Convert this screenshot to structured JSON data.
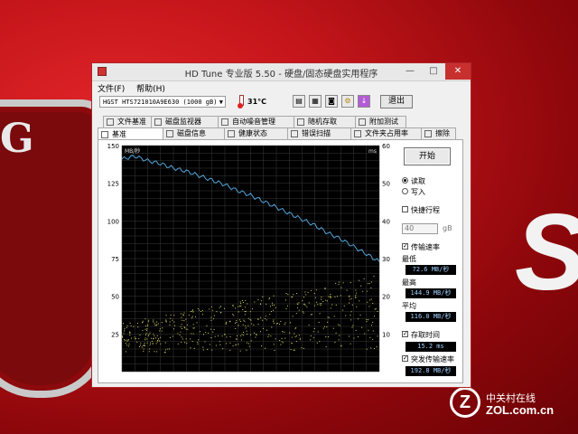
{
  "window": {
    "title": "HD Tune 专业版 5.50 - 硬盘/固态硬盘实用程序",
    "minimize": "—",
    "maximize": "□",
    "close": "✕"
  },
  "menu": {
    "file": "文件(F)",
    "help": "帮助(H)"
  },
  "toolbar": {
    "drive": "HGST HTS721010A9E630 (1000 gB)",
    "temperature": "31°C",
    "exit": "退出"
  },
  "tabs_row1": [
    {
      "label": "文件基准",
      "icon": "file-benchmark-icon"
    },
    {
      "label": "磁盘监视器",
      "icon": "disk-monitor-icon"
    },
    {
      "label": "自动噪音管理",
      "icon": "speaker-icon"
    },
    {
      "label": "随机存取",
      "icon": "random-access-icon"
    },
    {
      "label": "附加测试",
      "icon": "extra-tests-icon"
    }
  ],
  "tabs_row2": [
    {
      "label": "基准",
      "icon": "benchmark-icon"
    },
    {
      "label": "磁盘信息",
      "icon": "disk-info-icon"
    },
    {
      "label": "健康状态",
      "icon": "health-icon"
    },
    {
      "label": "错误扫描",
      "icon": "error-scan-icon"
    },
    {
      "label": "文件夹占用率",
      "icon": "folder-usage-icon"
    },
    {
      "label": "擦除",
      "icon": "erase-icon"
    }
  ],
  "side": {
    "start": "开始",
    "read": "读取",
    "write": "写入",
    "short_stroke": "快捷行程",
    "stroke_value": "40",
    "stroke_unit": "gB",
    "transfer_rate": "传输速率",
    "min_label": "最低",
    "min_value": "72.6 MB/秒",
    "max_label": "最高",
    "max_value": "144.9 MB/秒",
    "avg_label": "平均",
    "avg_value": "116.0 MB/秒",
    "access_time": "存取时间",
    "access_value": "15.2 ms",
    "burst_rate": "突发传输速率",
    "burst_value": "192.8 MB/秒"
  },
  "chart_data": {
    "type": "line",
    "left_unit": "MB/秒",
    "right_unit": "ms",
    "left_ticks": [
      150,
      125,
      100,
      75,
      50,
      25
    ],
    "right_ticks": [
      60,
      50,
      40,
      30,
      20,
      10
    ],
    "ylim_left": [
      0,
      150
    ],
    "ylim_right": [
      0,
      60
    ],
    "xlim": [
      0,
      100
    ],
    "grid": true,
    "series": [
      {
        "color": "#4fa3d8",
        "x": [
          0,
          5,
          10,
          15,
          20,
          25,
          30,
          35,
          40,
          45,
          50,
          55,
          60,
          65,
          70,
          75,
          80,
          85,
          90,
          95,
          100
        ],
        "values": [
          141,
          143,
          140,
          138,
          135,
          133,
          130,
          127,
          124,
          120,
          117,
          113,
          109,
          105,
          101,
          97,
          92,
          88,
          83,
          78,
          73
        ]
      }
    ],
    "scatter_color": "#d8d860",
    "access_band": {
      "ms_low_start": 5,
      "ms_high_start": 13,
      "ms_low_end": 6,
      "ms_high_end": 26
    }
  },
  "colors": {
    "accent": "#c7302e",
    "chart_bg": "#000000",
    "grid": "#3a3a3a"
  }
}
